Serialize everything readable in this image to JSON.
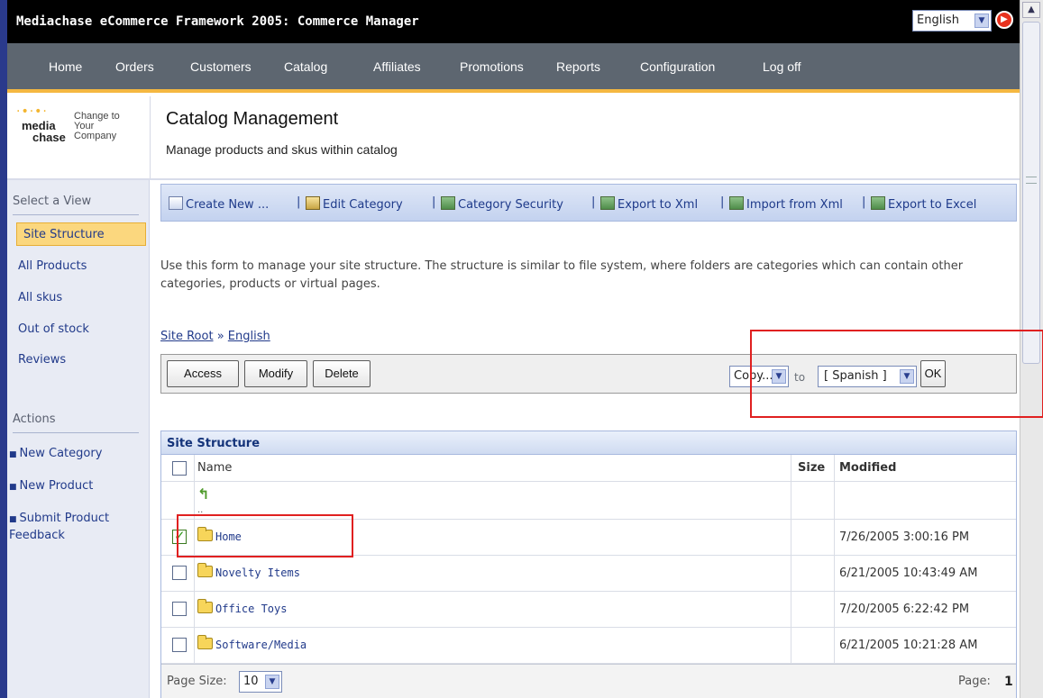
{
  "window": {
    "title": "Mediachase eCommerce Framework 2005: Commerce Manager",
    "language": "English"
  },
  "nav": [
    "Home",
    "Orders",
    "Customers",
    "Catalog",
    "Affiliates",
    "Promotions",
    "Reports",
    "Configuration",
    "Log off"
  ],
  "logo": {
    "line1": "media",
    "line2": "chase",
    "tagline1": "Change to",
    "tagline2": "Your",
    "tagline3": "Company"
  },
  "header": {
    "title": "Catalog Management",
    "subtitle": "Manage products and skus within catalog"
  },
  "sidebar": {
    "view_heading": "Select a View",
    "views": [
      "Site Structure",
      "All Products",
      "All skus",
      "Out of stock",
      "Reviews"
    ],
    "actions_heading": "Actions",
    "actions": [
      "New Category",
      "New Product",
      "Submit Product Feedback"
    ]
  },
  "toolbar": {
    "create_new": "Create New ...",
    "edit_category": "Edit Category",
    "category_security": "Category Security",
    "export_xml": "Export to Xml",
    "import_xml": "Import from Xml",
    "export_excel": "Export to Excel",
    "separator": "|"
  },
  "description": "Use this form to manage your site structure. The structure is similar to file system, where folders are categories which can contain other categories, products or virtual pages.",
  "breadcrumb": {
    "root": "Site Root",
    "separator": "»",
    "current": "English"
  },
  "actions_bar": {
    "access": "Access",
    "modify": "Modify",
    "delete": "Delete",
    "copy_select": "Copy...",
    "to_label": "to",
    "target_select": "[ Spanish ]",
    "ok": "OK"
  },
  "grid": {
    "title": "Site Structure",
    "columns": {
      "name": "Name",
      "size": "Size",
      "modified": "Modified"
    },
    "up_label": "..",
    "rows": [
      {
        "name": "Home",
        "modified": "7/26/2005 3:00:16 PM",
        "checked": true
      },
      {
        "name": "Novelty Items",
        "modified": "6/21/2005 10:43:49 AM",
        "checked": false
      },
      {
        "name": "Office Toys",
        "modified": "7/20/2005 6:22:42 PM",
        "checked": false
      },
      {
        "name": "Software/Media",
        "modified": "6/21/2005 10:21:28 AM",
        "checked": false
      }
    ],
    "page_size_label": "Page Size:",
    "page_size": "10",
    "page_label": "Page:",
    "page": "1"
  },
  "colors": {
    "nav_bg": "#5d6670",
    "nav_accent": "#f5b841",
    "sidebar_bg": "#e8ebf4",
    "link": "#213a8a",
    "highlight": "#e02020"
  }
}
